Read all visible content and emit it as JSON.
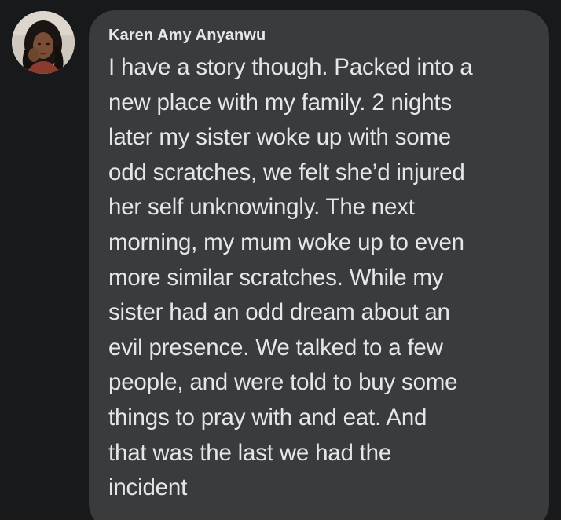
{
  "comment": {
    "author": "Karen Amy Anyanwu",
    "lines": [
      "I have a story though. Packed into a",
      "new place with my family. 2 nights",
      "later my sister woke up with some",
      "odd scratches, we felt she’d injured",
      "her self unknowingly. The next",
      "morning, my mum woke up to even",
      "more similar scratches. While my",
      "sister had an odd dream about an",
      "evil presence. We talked to a few",
      "people, and were told to buy some",
      "things to pray with and eat. And",
      "that was the last we had the",
      "incident"
    ]
  },
  "colors": {
    "background": "#18191a",
    "bubble": "#3a3b3c",
    "text": "#e4e6eb"
  }
}
